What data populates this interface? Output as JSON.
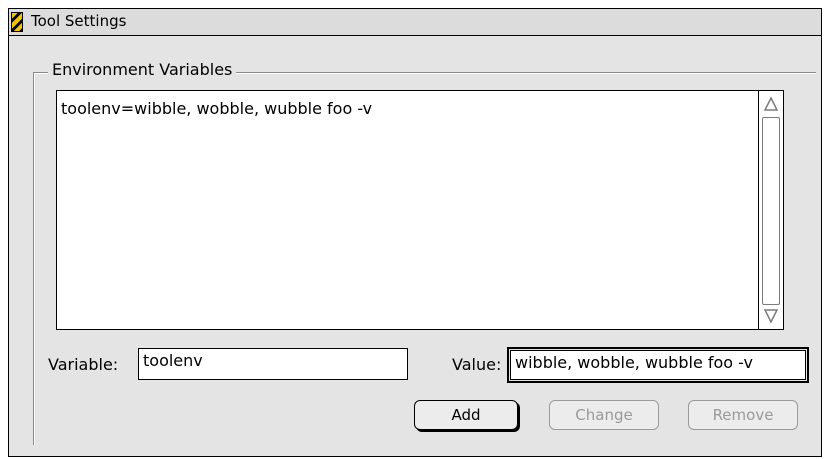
{
  "window": {
    "title": "Tool Settings"
  },
  "group": {
    "label": "Environment Variables"
  },
  "list": {
    "items": [
      "toolenv=wibble, wobble, wubble foo -v"
    ]
  },
  "fields": {
    "variable_label": "Variable:",
    "variable_value": "toolenv",
    "value_label": "Value:",
    "value_value": "wibble, wobble, wubble foo -v"
  },
  "buttons": {
    "add": "Add",
    "change": "Change",
    "remove": "Remove"
  },
  "icons": {
    "title": "window-app-icon",
    "scroll_up": "scroll-up-arrow-icon",
    "scroll_down": "scroll-down-arrow-icon"
  },
  "colors": {
    "window_bg": "#e4e4e4",
    "icon_stripe": "#f2c200"
  }
}
